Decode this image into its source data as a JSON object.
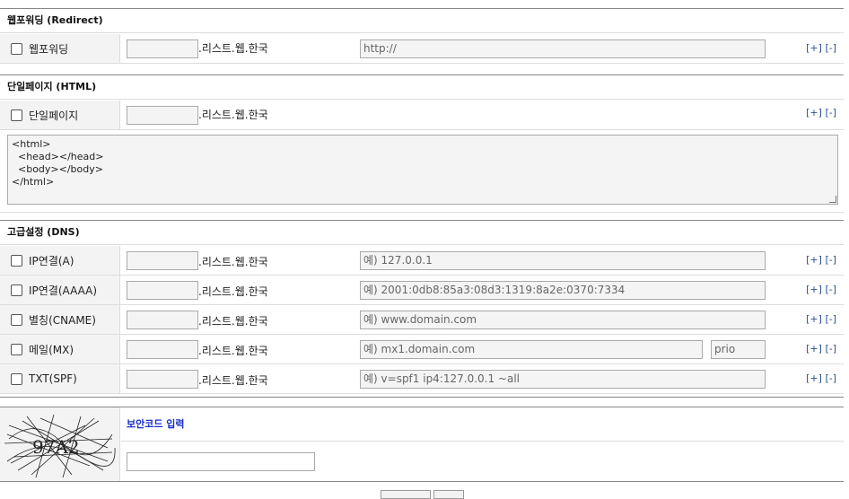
{
  "domain_suffix": ".리스트.웹.한국",
  "controls": {
    "add": "[+]",
    "remove": "[-]"
  },
  "redirect": {
    "title": "웹포워딩 (Redirect)",
    "row": {
      "label": "웹포워딩",
      "url_value": "http://"
    }
  },
  "single_page": {
    "title": "단일페이지 (HTML)",
    "row": {
      "label": "단일페이지"
    },
    "html_value": "<html>\n  <head></head>\n  <body></body>\n</html>"
  },
  "dns": {
    "title": "고급설정 (DNS)",
    "rows": [
      {
        "label": "IP연결(A)",
        "placeholder": "예) 127.0.0.1"
      },
      {
        "label": "IP연결(AAAA)",
        "placeholder": "예) 2001:0db8:85a3:08d3:1319:8a2e:0370:7334"
      },
      {
        "label": "별칭(CNAME)",
        "placeholder": "예) www.domain.com"
      },
      {
        "label": "메일(MX)",
        "placeholder": "예) mx1.domain.com",
        "prio_placeholder": "prio"
      },
      {
        "label": "TXT(SPF)",
        "placeholder": "예) v=spf1 ip4:127.0.0.1 ~all"
      }
    ]
  },
  "captcha": {
    "code": "97A2",
    "label": "보안코드 입력",
    "input_value": ""
  }
}
